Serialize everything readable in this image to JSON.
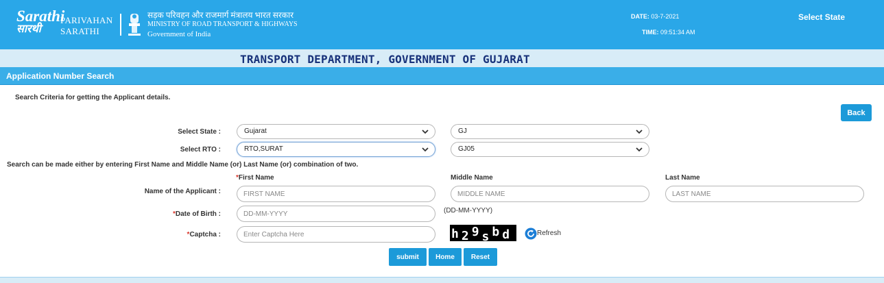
{
  "header": {
    "logo_sarathi_line1": "Sarathi",
    "logo_sarathi_line2": "सारथी",
    "logo_parivahan_line1": "PARIVAHAN",
    "logo_parivahan_line2": "SARATHI",
    "ministry_hindi": "सड़क परिवहन और राजमार्ग मंत्रालय भारत सरकार",
    "ministry_english": "MINISTRY OF ROAD TRANSPORT & HIGHWAYS",
    "ministry_gov": "Government of India",
    "date_label": "DATE:",
    "date_value": "03-7-2021",
    "time_label": "TIME:",
    "time_value": "09:51:34 AM",
    "select_state_link": "Select State"
  },
  "banner": {
    "title": "TRANSPORT DEPARTMENT, GOVERNMENT OF GUJARAT"
  },
  "section": {
    "title": "Application Number Search"
  },
  "form": {
    "criteria_text": "Search Criteria for getting the Applicant details.",
    "back_label": "Back",
    "select_state_label": "Select State :",
    "state_value": "Gujarat",
    "state_code_value": "GJ",
    "select_rto_label": "Select RTO :",
    "rto_value": "RTO,SURAT",
    "rto_code_value": "GJ05",
    "note_text": "Search can be made either by entering First Name and Middle Name (or) Last Name (or) combination of two.",
    "required_mark": "*",
    "first_name_head": "First Name",
    "middle_name_head": "Middle Name",
    "last_name_head": "Last Name",
    "name_label": "Name of the Applicant :",
    "first_name_placeholder": "FIRST NAME",
    "middle_name_placeholder": "MIDDLE NAME",
    "last_name_placeholder": "LAST NAME",
    "dob_label": "Date of Birth :",
    "dob_placeholder": "DD-MM-YYYY",
    "dob_hint": "(DD-MM-YYYY)",
    "captcha_label": "Captcha :",
    "captcha_placeholder": "Enter Captcha Here",
    "captcha_text": "h29sbd",
    "refresh_label": "Refresh",
    "submit_label": "submit",
    "home_label": "Home",
    "reset_label": "Reset"
  },
  "colors": {
    "header_blue": "#2aa7e8",
    "banner_bg": "#d8ecf7",
    "banner_text": "#17317a",
    "button_blue": "#1c9ad9",
    "required_red": "#d9362b"
  }
}
